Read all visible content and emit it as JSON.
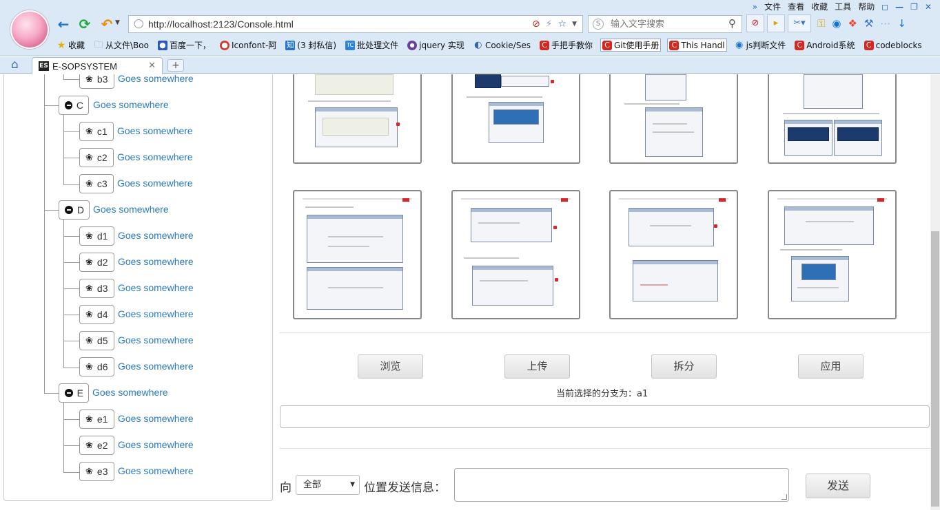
{
  "browser": {
    "url": "http://localhost:2123/Console.html",
    "search_placeholder": "输入文字搜索",
    "menu": [
      "»",
      "文件",
      "查看",
      "收藏",
      "工具",
      "帮助"
    ],
    "bookmarks": [
      {
        "icon": "star-icon",
        "label": "收藏"
      },
      {
        "icon": "folder-icon",
        "label": "从文件\\Boo"
      },
      {
        "icon": "baidu-paw-icon",
        "label": "百度一下，"
      },
      {
        "icon": "iconfont-icon",
        "label": "Iconfont-阿"
      },
      {
        "icon": "zhihu-icon",
        "label": "(3 封私信)"
      },
      {
        "icon": "tc-icon",
        "label": "批处理文件"
      },
      {
        "icon": "jquery-icon",
        "label": "jquery 实现"
      },
      {
        "icon": "cookie-icon",
        "label": "Cookie/Ses"
      },
      {
        "icon": "csdn-icon",
        "label": "手把手教你"
      },
      {
        "icon": "csdn-icon",
        "label": "Git使用手册"
      },
      {
        "icon": "csdn-icon",
        "label": "This Handl"
      },
      {
        "icon": "js-icon",
        "label": "js判断文件"
      },
      {
        "icon": "csdn-icon",
        "label": "Android系统"
      },
      {
        "icon": "csdn-icon",
        "label": "codeblocks"
      }
    ],
    "tab_title": "E-SOPSYSTEM",
    "tab_favicon": "ES"
  },
  "tree": {
    "link_text": "Goes somewhere",
    "nodes": [
      {
        "label": "b3",
        "kind": "leaf"
      },
      {
        "label": "C",
        "kind": "branch"
      },
      {
        "label": "c1",
        "kind": "leaf"
      },
      {
        "label": "c2",
        "kind": "leaf"
      },
      {
        "label": "c3",
        "kind": "leaf"
      },
      {
        "label": "D",
        "kind": "branch"
      },
      {
        "label": "d1",
        "kind": "leaf"
      },
      {
        "label": "d2",
        "kind": "leaf"
      },
      {
        "label": "d3",
        "kind": "leaf"
      },
      {
        "label": "d4",
        "kind": "leaf"
      },
      {
        "label": "d5",
        "kind": "leaf"
      },
      {
        "label": "d6",
        "kind": "leaf"
      },
      {
        "label": "E",
        "kind": "branch"
      },
      {
        "label": "e1",
        "kind": "leaf"
      },
      {
        "label": "e2",
        "kind": "leaf"
      },
      {
        "label": "e3",
        "kind": "leaf"
      }
    ]
  },
  "main": {
    "buttons": {
      "browse": "浏览",
      "upload": "上传",
      "split": "拆分",
      "apply": "应用"
    },
    "branch_status": "当前选择的分支为：a1",
    "send": {
      "to_label": "向",
      "target_selected": "全部",
      "position_label": "位置发送信息：",
      "send_button": "发送"
    }
  },
  "colors": {
    "link": "#2a7bbf",
    "chrome": "#dbe9f7"
  }
}
